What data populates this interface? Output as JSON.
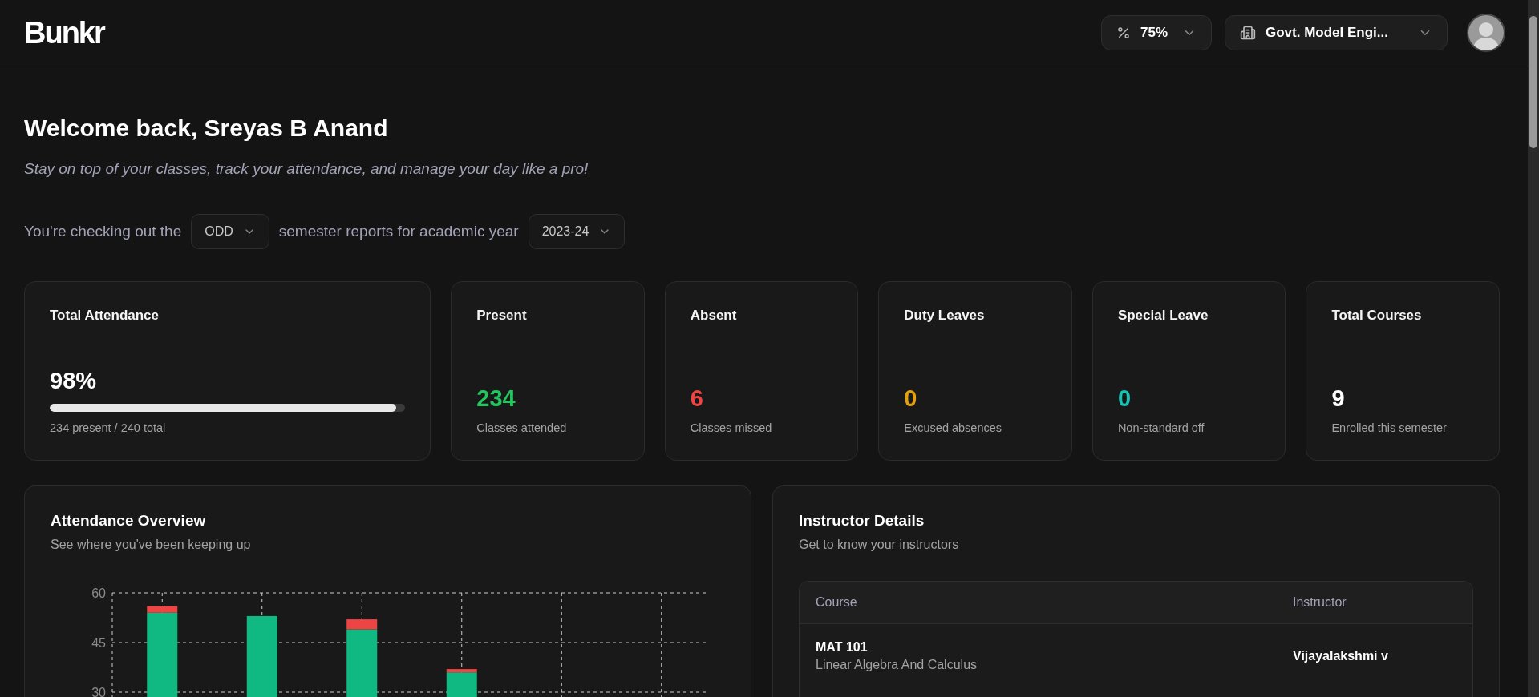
{
  "header": {
    "logo": "Bunkr",
    "threshold": {
      "value": "75%"
    },
    "institution": {
      "value": "Govt. Model Engi..."
    }
  },
  "welcome": {
    "title": "Welcome back, Sreyas B Anand",
    "subtitle": "Stay on top of your classes, track your attendance, and manage your day like a pro!"
  },
  "filter": {
    "text_before": "You're checking out the",
    "semester": "ODD",
    "text_middle": "semester reports for academic year",
    "year": "2023-24"
  },
  "summary": {
    "title": "Total Attendance",
    "value": "98%",
    "level": 0.975,
    "caption": "234 present / 240 total"
  },
  "stats": [
    {
      "title": "Present",
      "value": "234",
      "caption": "Classes attended",
      "color": "#22c55e"
    },
    {
      "title": "Absent",
      "value": "6",
      "caption": "Classes missed",
      "color": "#ef4444"
    },
    {
      "title": "Duty Leaves",
      "value": "0",
      "caption": "Excused absences",
      "color": "#e5a00d"
    },
    {
      "title": "Special Leave",
      "value": "0",
      "caption": "Non-standard off",
      "color": "#14c4b4"
    },
    {
      "title": "Total Courses",
      "value": "9",
      "caption": "Enrolled this semester",
      "color": "#ffffff"
    }
  ],
  "overview": {
    "title": "Attendance Overview",
    "subtitle": "See where you've been keeping up",
    "chart_data": {
      "type": "bar",
      "stacked": true,
      "grid": true,
      "ylim": [
        0,
        60
      ],
      "yticks": [
        30,
        45,
        60
      ],
      "series": [
        {
          "color": "#10b981",
          "values": [
            54,
            53,
            49,
            36,
            null,
            null
          ]
        },
        {
          "color": "#ef4444",
          "values": [
            2,
            0,
            3,
            1,
            null,
            null
          ]
        }
      ]
    }
  },
  "instructors": {
    "title": "Instructor Details",
    "subtitle": "Get to know your instructors",
    "columns": [
      "Course",
      "Instructor"
    ],
    "rows": [
      {
        "code": "MAT 101",
        "course": "Linear Algebra And Calculus",
        "instructor": "Vijayalakshmi v"
      }
    ]
  }
}
